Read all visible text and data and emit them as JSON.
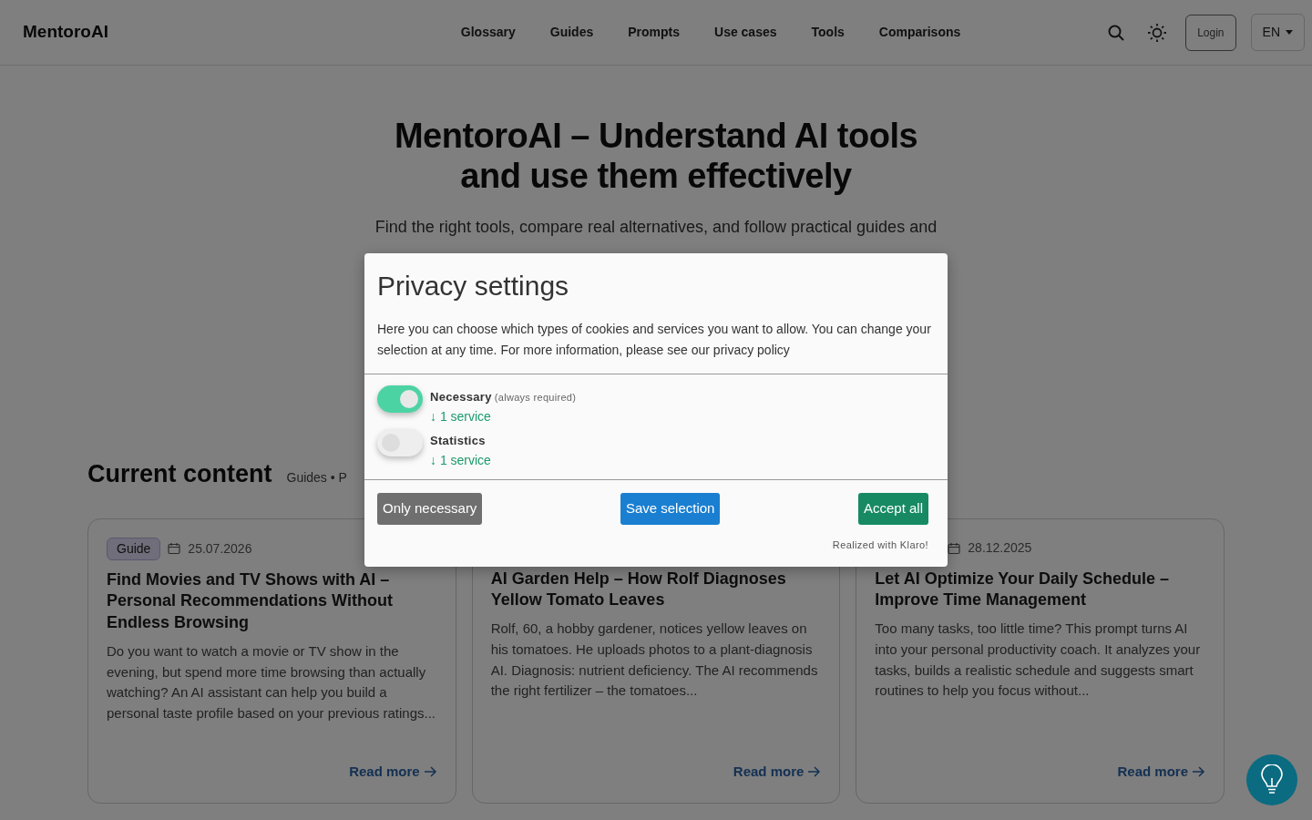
{
  "nav": {
    "brand": "MentoroAI",
    "links": [
      "Glossary",
      "Guides",
      "Prompts",
      "Use cases",
      "Tools",
      "Comparisons"
    ],
    "login": "Login",
    "language": "EN"
  },
  "hero": {
    "title_lines": [
      "MentoroAI – Understand AI tools",
      "and use them effectively"
    ],
    "subtitle": "Find the right tools, compare real alternatives, and follow practical guides and"
  },
  "section": {
    "title": "Current content",
    "subtitle": "Guides • P"
  },
  "cards": [
    {
      "badge": "Guide",
      "date": "25.07.2026",
      "title": "Find Movies and TV Shows with AI – Personal Recommendations Without Endless Browsing",
      "excerpt": "Do you want to watch a movie or TV show in the evening, but spend more time browsing than actually watching? An AI assistant can help you build a personal taste profile based on your previous ratings...",
      "link": "Read more"
    },
    {
      "title": "AI Garden Help – How Rolf Diagnoses Yellow Tomato Leaves",
      "excerpt": "Rolf, 60, a hobby gardener, notices yellow leaves on his tomatoes. He uploads photos to a plant-diagnosis AI. Diagnosis: nutrient deficiency. The AI recommends the right fertilizer – the tomatoes...",
      "link": "Read more"
    },
    {
      "date": "28.12.2025",
      "title": "Let AI Optimize Your Daily Schedule – Improve Time Management",
      "excerpt": "Too many tasks, too little time? This prompt turns AI into your personal productivity coach. It analyzes your tasks, builds a realistic schedule and suggests smart routines to help you focus without...",
      "link": "Read more"
    }
  ],
  "consent": {
    "title": "Privacy settings",
    "description": "Here you can choose which types of cookies and services you want to allow. You can change your selection at any time. For more information, please see our privacy policy",
    "purposes": [
      {
        "name": "Necessary",
        "note": "(always required)",
        "services": "↓ 1 service",
        "on": true
      },
      {
        "name": "Statistics",
        "services": "↓ 1 service",
        "on": false
      }
    ],
    "buttons": [
      {
        "label": "Only necessary",
        "kind": "secondary"
      },
      {
        "label": "Save selection",
        "kind": "primary"
      },
      {
        "label": "Accept all",
        "kind": "success"
      }
    ],
    "footer": "Realized with Klaro!"
  }
}
